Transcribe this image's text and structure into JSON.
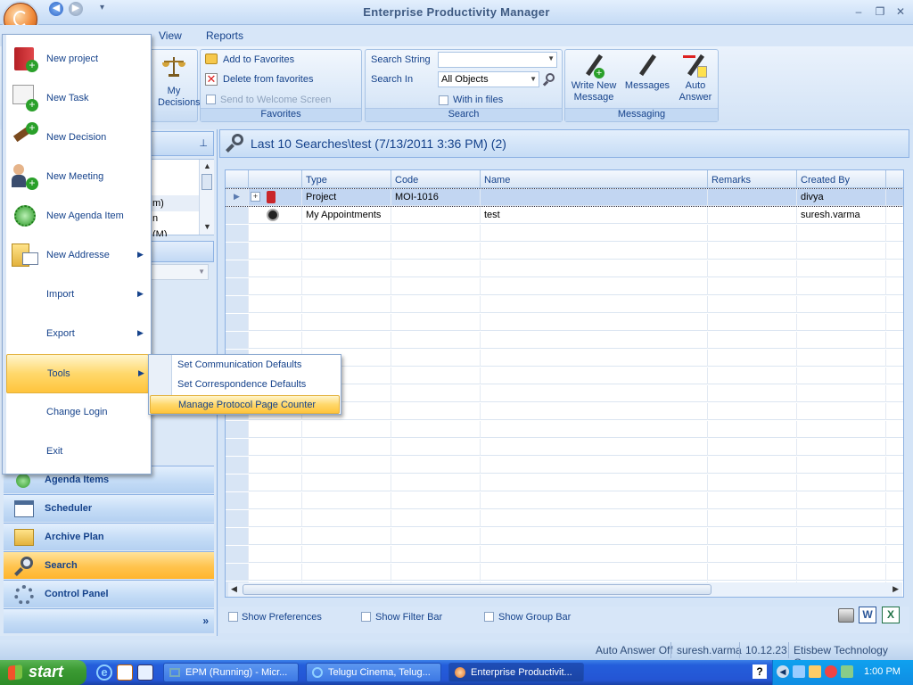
{
  "window": {
    "title": "Enterprise Productivity Manager"
  },
  "menu": {
    "view": "View",
    "reports": "Reports"
  },
  "ribbon": {
    "my_decisions_line1": "My",
    "my_decisions_line2": "Decisions",
    "add_favorites": "Add to Favorites",
    "delete_favorites": "Delete from favorites",
    "send_welcome": "Send to Welcome Screen",
    "favorites_group": "Favorites",
    "search_string_label": "Search String",
    "search_string_value": "",
    "search_in_label": "Search In",
    "search_in_value": "All Objects",
    "within_files": "With in files",
    "search_group": "Search",
    "write_new_message_line1": "Write New",
    "write_new_message_line2": "Message",
    "messages": "Messages",
    "auto_answer_line1": "Auto",
    "auto_answer_line2": "Answer",
    "messaging_group": "Messaging"
  },
  "app_menu": {
    "items": [
      {
        "label": "New project",
        "icon": "new-project-icon"
      },
      {
        "label": "New Task",
        "icon": "new-task-icon"
      },
      {
        "label": "New Decision",
        "icon": "new-decision-icon"
      },
      {
        "label": "New Meeting",
        "icon": "new-meeting-icon"
      },
      {
        "label": "New Agenda Item",
        "icon": "new-agenda-item-icon"
      },
      {
        "label": "New Addresse",
        "icon": "new-addresse-icon"
      },
      {
        "label": "Import",
        "icon": ""
      },
      {
        "label": "Export",
        "icon": ""
      },
      {
        "label": "Tools",
        "icon": ""
      },
      {
        "label": "Change Login",
        "icon": ""
      },
      {
        "label": "Exit",
        "icon": ""
      }
    ],
    "tools_submenu": [
      "Set Communication Defaults",
      "Set Correspondence Defaults",
      "Manage Protocol Page Counter"
    ]
  },
  "left_nav": {
    "partial_items": [
      "m)",
      "n",
      "(M)"
    ],
    "buttons": [
      "Agenda Items",
      "Scheduler",
      "Archive Plan",
      "Search",
      "Control Panel"
    ],
    "active": "Search"
  },
  "main": {
    "title": "Last 10 Searches\\test (7/13/2011 3:36 PM) (2)",
    "columns": [
      "Type",
      "Code",
      "Name",
      "Remarks",
      "Created By"
    ],
    "rows": [
      {
        "type": "Project",
        "code": "MOI-1016",
        "name": "",
        "remarks": "",
        "created_by": "divya"
      },
      {
        "type": "My Appointments",
        "code": "",
        "name": "test",
        "remarks": "",
        "created_by": "suresh.varma"
      }
    ],
    "options": {
      "show_preferences": "Show Preferences",
      "show_filter_bar": "Show Filter Bar",
      "show_group_bar": "Show Group Bar"
    }
  },
  "status": {
    "auto_answer": "Auto Answer Off",
    "user": "suresh.varma",
    "version": "10.12.23",
    "company": "Etisbew Technology Group"
  },
  "taskbar": {
    "start": "start",
    "tasks": [
      "EPM (Running) - Micr...",
      "Telugu Cinema, Telug...",
      "Enterprise Productivit..."
    ],
    "clock": "1:00 PM"
  },
  "colors": {
    "accent": "#ffc34d",
    "ribbon": "#dae8f8",
    "title_text": "#15428b"
  }
}
